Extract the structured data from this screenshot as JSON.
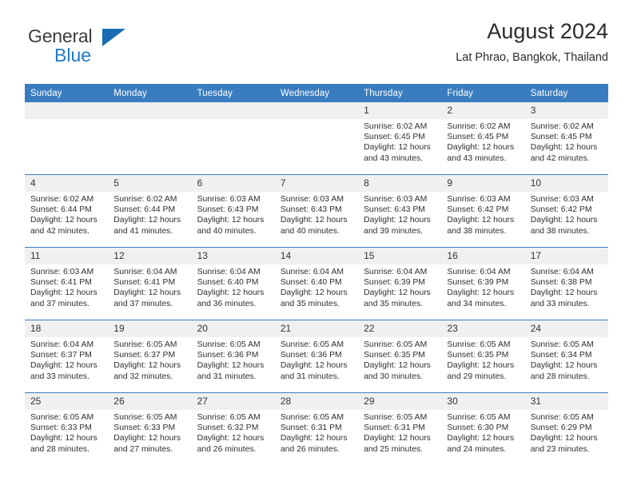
{
  "brand": {
    "name_top": "General",
    "name_bottom": "Blue",
    "accent_color": "#1f7ac4",
    "triangle_color": "#1a6cb5"
  },
  "header": {
    "title": "August 2024",
    "subtitle": "Lat Phrao, Bangkok, Thailand"
  },
  "theme": {
    "header_row_bg": "#3a7cc0",
    "header_row_text": "#ffffff",
    "daynum_bg": "#f0f0f0",
    "grid_line": "#3a7cc0"
  },
  "weekdays": [
    "Sunday",
    "Monday",
    "Tuesday",
    "Wednesday",
    "Thursday",
    "Friday",
    "Saturday"
  ],
  "labels": {
    "sunrise_prefix": "Sunrise:",
    "sunset_prefix": "Sunset:",
    "daylight_prefix": "Daylight:"
  },
  "weeks": [
    [
      {
        "day": "",
        "sunrise": "",
        "sunset": "",
        "daylight_line1": "",
        "daylight_line2": "",
        "empty": true
      },
      {
        "day": "",
        "sunrise": "",
        "sunset": "",
        "daylight_line1": "",
        "daylight_line2": "",
        "empty": true
      },
      {
        "day": "",
        "sunrise": "",
        "sunset": "",
        "daylight_line1": "",
        "daylight_line2": "",
        "empty": true
      },
      {
        "day": "",
        "sunrise": "",
        "sunset": "",
        "daylight_line1": "",
        "daylight_line2": "",
        "empty": true
      },
      {
        "day": "1",
        "sunrise": "Sunrise: 6:02 AM",
        "sunset": "Sunset: 6:45 PM",
        "daylight_line1": "Daylight: 12 hours",
        "daylight_line2": "and 43 minutes."
      },
      {
        "day": "2",
        "sunrise": "Sunrise: 6:02 AM",
        "sunset": "Sunset: 6:45 PM",
        "daylight_line1": "Daylight: 12 hours",
        "daylight_line2": "and 43 minutes."
      },
      {
        "day": "3",
        "sunrise": "Sunrise: 6:02 AM",
        "sunset": "Sunset: 6:45 PM",
        "daylight_line1": "Daylight: 12 hours",
        "daylight_line2": "and 42 minutes."
      }
    ],
    [
      {
        "day": "4",
        "sunrise": "Sunrise: 6:02 AM",
        "sunset": "Sunset: 6:44 PM",
        "daylight_line1": "Daylight: 12 hours",
        "daylight_line2": "and 42 minutes."
      },
      {
        "day": "5",
        "sunrise": "Sunrise: 6:02 AM",
        "sunset": "Sunset: 6:44 PM",
        "daylight_line1": "Daylight: 12 hours",
        "daylight_line2": "and 41 minutes."
      },
      {
        "day": "6",
        "sunrise": "Sunrise: 6:03 AM",
        "sunset": "Sunset: 6:43 PM",
        "daylight_line1": "Daylight: 12 hours",
        "daylight_line2": "and 40 minutes."
      },
      {
        "day": "7",
        "sunrise": "Sunrise: 6:03 AM",
        "sunset": "Sunset: 6:43 PM",
        "daylight_line1": "Daylight: 12 hours",
        "daylight_line2": "and 40 minutes."
      },
      {
        "day": "8",
        "sunrise": "Sunrise: 6:03 AM",
        "sunset": "Sunset: 6:43 PM",
        "daylight_line1": "Daylight: 12 hours",
        "daylight_line2": "and 39 minutes."
      },
      {
        "day": "9",
        "sunrise": "Sunrise: 6:03 AM",
        "sunset": "Sunset: 6:42 PM",
        "daylight_line1": "Daylight: 12 hours",
        "daylight_line2": "and 38 minutes."
      },
      {
        "day": "10",
        "sunrise": "Sunrise: 6:03 AM",
        "sunset": "Sunset: 6:42 PM",
        "daylight_line1": "Daylight: 12 hours",
        "daylight_line2": "and 38 minutes."
      }
    ],
    [
      {
        "day": "11",
        "sunrise": "Sunrise: 6:03 AM",
        "sunset": "Sunset: 6:41 PM",
        "daylight_line1": "Daylight: 12 hours",
        "daylight_line2": "and 37 minutes."
      },
      {
        "day": "12",
        "sunrise": "Sunrise: 6:04 AM",
        "sunset": "Sunset: 6:41 PM",
        "daylight_line1": "Daylight: 12 hours",
        "daylight_line2": "and 37 minutes."
      },
      {
        "day": "13",
        "sunrise": "Sunrise: 6:04 AM",
        "sunset": "Sunset: 6:40 PM",
        "daylight_line1": "Daylight: 12 hours",
        "daylight_line2": "and 36 minutes."
      },
      {
        "day": "14",
        "sunrise": "Sunrise: 6:04 AM",
        "sunset": "Sunset: 6:40 PM",
        "daylight_line1": "Daylight: 12 hours",
        "daylight_line2": "and 35 minutes."
      },
      {
        "day": "15",
        "sunrise": "Sunrise: 6:04 AM",
        "sunset": "Sunset: 6:39 PM",
        "daylight_line1": "Daylight: 12 hours",
        "daylight_line2": "and 35 minutes."
      },
      {
        "day": "16",
        "sunrise": "Sunrise: 6:04 AM",
        "sunset": "Sunset: 6:39 PM",
        "daylight_line1": "Daylight: 12 hours",
        "daylight_line2": "and 34 minutes."
      },
      {
        "day": "17",
        "sunrise": "Sunrise: 6:04 AM",
        "sunset": "Sunset: 6:38 PM",
        "daylight_line1": "Daylight: 12 hours",
        "daylight_line2": "and 33 minutes."
      }
    ],
    [
      {
        "day": "18",
        "sunrise": "Sunrise: 6:04 AM",
        "sunset": "Sunset: 6:37 PM",
        "daylight_line1": "Daylight: 12 hours",
        "daylight_line2": "and 33 minutes."
      },
      {
        "day": "19",
        "sunrise": "Sunrise: 6:05 AM",
        "sunset": "Sunset: 6:37 PM",
        "daylight_line1": "Daylight: 12 hours",
        "daylight_line2": "and 32 minutes."
      },
      {
        "day": "20",
        "sunrise": "Sunrise: 6:05 AM",
        "sunset": "Sunset: 6:36 PM",
        "daylight_line1": "Daylight: 12 hours",
        "daylight_line2": "and 31 minutes."
      },
      {
        "day": "21",
        "sunrise": "Sunrise: 6:05 AM",
        "sunset": "Sunset: 6:36 PM",
        "daylight_line1": "Daylight: 12 hours",
        "daylight_line2": "and 31 minutes."
      },
      {
        "day": "22",
        "sunrise": "Sunrise: 6:05 AM",
        "sunset": "Sunset: 6:35 PM",
        "daylight_line1": "Daylight: 12 hours",
        "daylight_line2": "and 30 minutes."
      },
      {
        "day": "23",
        "sunrise": "Sunrise: 6:05 AM",
        "sunset": "Sunset: 6:35 PM",
        "daylight_line1": "Daylight: 12 hours",
        "daylight_line2": "and 29 minutes."
      },
      {
        "day": "24",
        "sunrise": "Sunrise: 6:05 AM",
        "sunset": "Sunset: 6:34 PM",
        "daylight_line1": "Daylight: 12 hours",
        "daylight_line2": "and 28 minutes."
      }
    ],
    [
      {
        "day": "25",
        "sunrise": "Sunrise: 6:05 AM",
        "sunset": "Sunset: 6:33 PM",
        "daylight_line1": "Daylight: 12 hours",
        "daylight_line2": "and 28 minutes."
      },
      {
        "day": "26",
        "sunrise": "Sunrise: 6:05 AM",
        "sunset": "Sunset: 6:33 PM",
        "daylight_line1": "Daylight: 12 hours",
        "daylight_line2": "and 27 minutes."
      },
      {
        "day": "27",
        "sunrise": "Sunrise: 6:05 AM",
        "sunset": "Sunset: 6:32 PM",
        "daylight_line1": "Daylight: 12 hours",
        "daylight_line2": "and 26 minutes."
      },
      {
        "day": "28",
        "sunrise": "Sunrise: 6:05 AM",
        "sunset": "Sunset: 6:31 PM",
        "daylight_line1": "Daylight: 12 hours",
        "daylight_line2": "and 26 minutes."
      },
      {
        "day": "29",
        "sunrise": "Sunrise: 6:05 AM",
        "sunset": "Sunset: 6:31 PM",
        "daylight_line1": "Daylight: 12 hours",
        "daylight_line2": "and 25 minutes."
      },
      {
        "day": "30",
        "sunrise": "Sunrise: 6:05 AM",
        "sunset": "Sunset: 6:30 PM",
        "daylight_line1": "Daylight: 12 hours",
        "daylight_line2": "and 24 minutes."
      },
      {
        "day": "31",
        "sunrise": "Sunrise: 6:05 AM",
        "sunset": "Sunset: 6:29 PM",
        "daylight_line1": "Daylight: 12 hours",
        "daylight_line2": "and 23 minutes."
      }
    ]
  ]
}
